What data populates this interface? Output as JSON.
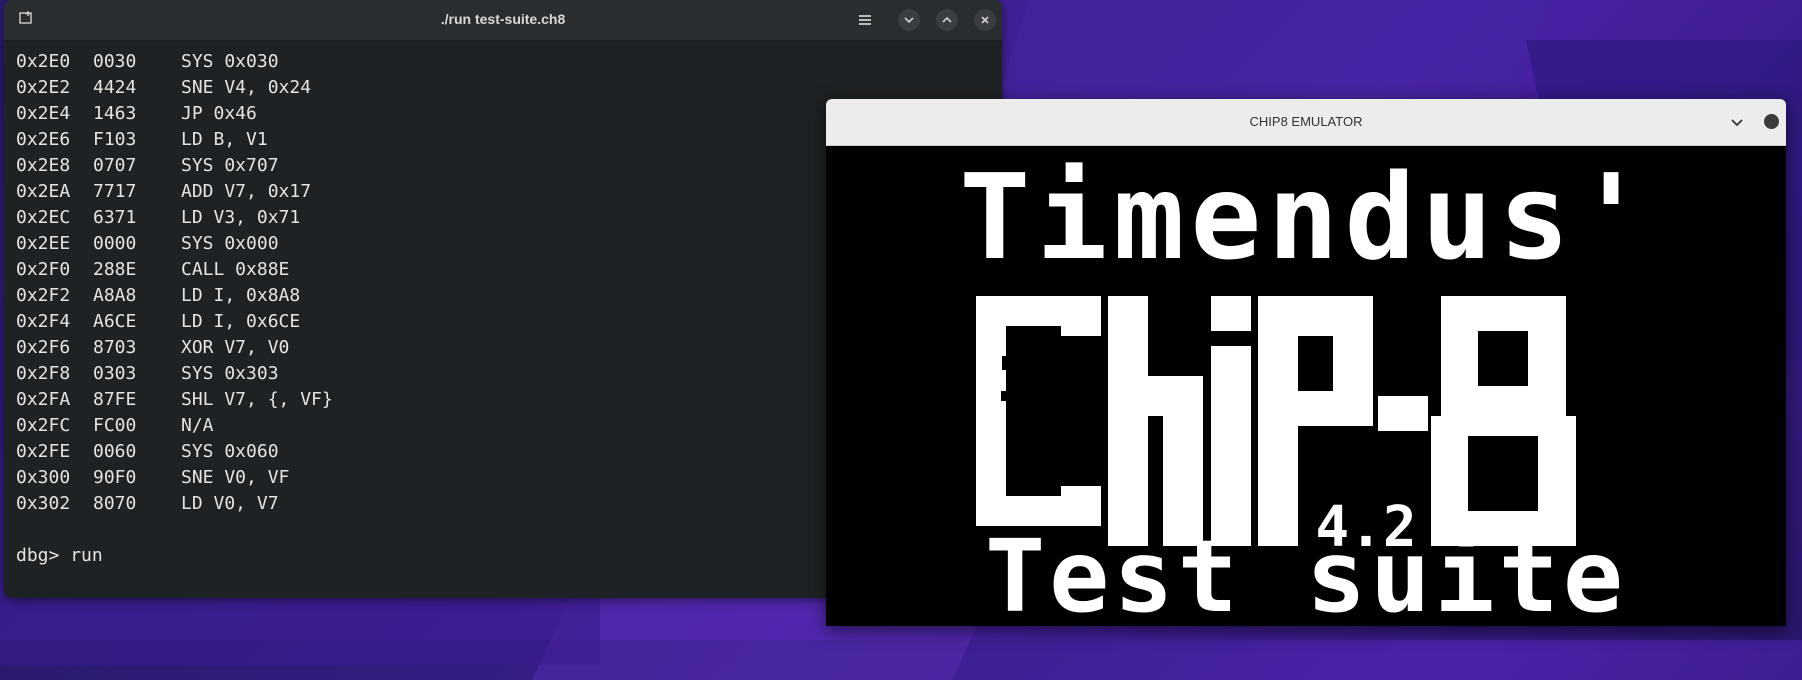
{
  "terminal": {
    "title": "./run test-suite.ch8",
    "lines": [
      {
        "addr": "0x2E0",
        "opcode": "0030",
        "instr": "SYS 0x030"
      },
      {
        "addr": "0x2E2",
        "opcode": "4424",
        "instr": "SNE V4, 0x24"
      },
      {
        "addr": "0x2E4",
        "opcode": "1463",
        "instr": "JP 0x46"
      },
      {
        "addr": "0x2E6",
        "opcode": "F103",
        "instr": "LD B, V1"
      },
      {
        "addr": "0x2E8",
        "opcode": "0707",
        "instr": "SYS 0x707"
      },
      {
        "addr": "0x2EA",
        "opcode": "7717",
        "instr": "ADD V7, 0x17"
      },
      {
        "addr": "0x2EC",
        "opcode": "6371",
        "instr": "LD V3, 0x71"
      },
      {
        "addr": "0x2EE",
        "opcode": "0000",
        "instr": "SYS 0x000"
      },
      {
        "addr": "0x2F0",
        "opcode": "288E",
        "instr": "CALL 0x88E"
      },
      {
        "addr": "0x2F2",
        "opcode": "A8A8",
        "instr": "LD I, 0x8A8"
      },
      {
        "addr": "0x2F4",
        "opcode": "A6CE",
        "instr": "LD I, 0x6CE"
      },
      {
        "addr": "0x2F6",
        "opcode": "8703",
        "instr": "XOR V7, V0"
      },
      {
        "addr": "0x2F8",
        "opcode": "0303",
        "instr": "SYS 0x303"
      },
      {
        "addr": "0x2FA",
        "opcode": "87FE",
        "instr": "SHL V7, {, VF}"
      },
      {
        "addr": "0x2FC",
        "opcode": "FC00",
        "instr": "N/A"
      },
      {
        "addr": "0x2FE",
        "opcode": "0060",
        "instr": "SYS 0x060"
      },
      {
        "addr": "0x300",
        "opcode": "90F0",
        "instr": "SNE V0, VF"
      },
      {
        "addr": "0x302",
        "opcode": "8070",
        "instr": "LD V0, V7"
      }
    ],
    "prompt": "dbg> ",
    "command": "run",
    "icons": {
      "new_tab": "new-tab-icon",
      "menu": "hamburger-menu-icon",
      "minimize": "chevron-down-icon",
      "maximize": "chevron-up-icon",
      "close": "close-icon"
    }
  },
  "emulator": {
    "title": "CHIP8 EMULATOR",
    "screen": {
      "line1": "Timendus'",
      "logo": "CHIP-8",
      "version": "4.2",
      "line3": "Test suite"
    },
    "colors": {
      "pixel_on": "#ffffff",
      "pixel_off": "#000000"
    }
  }
}
